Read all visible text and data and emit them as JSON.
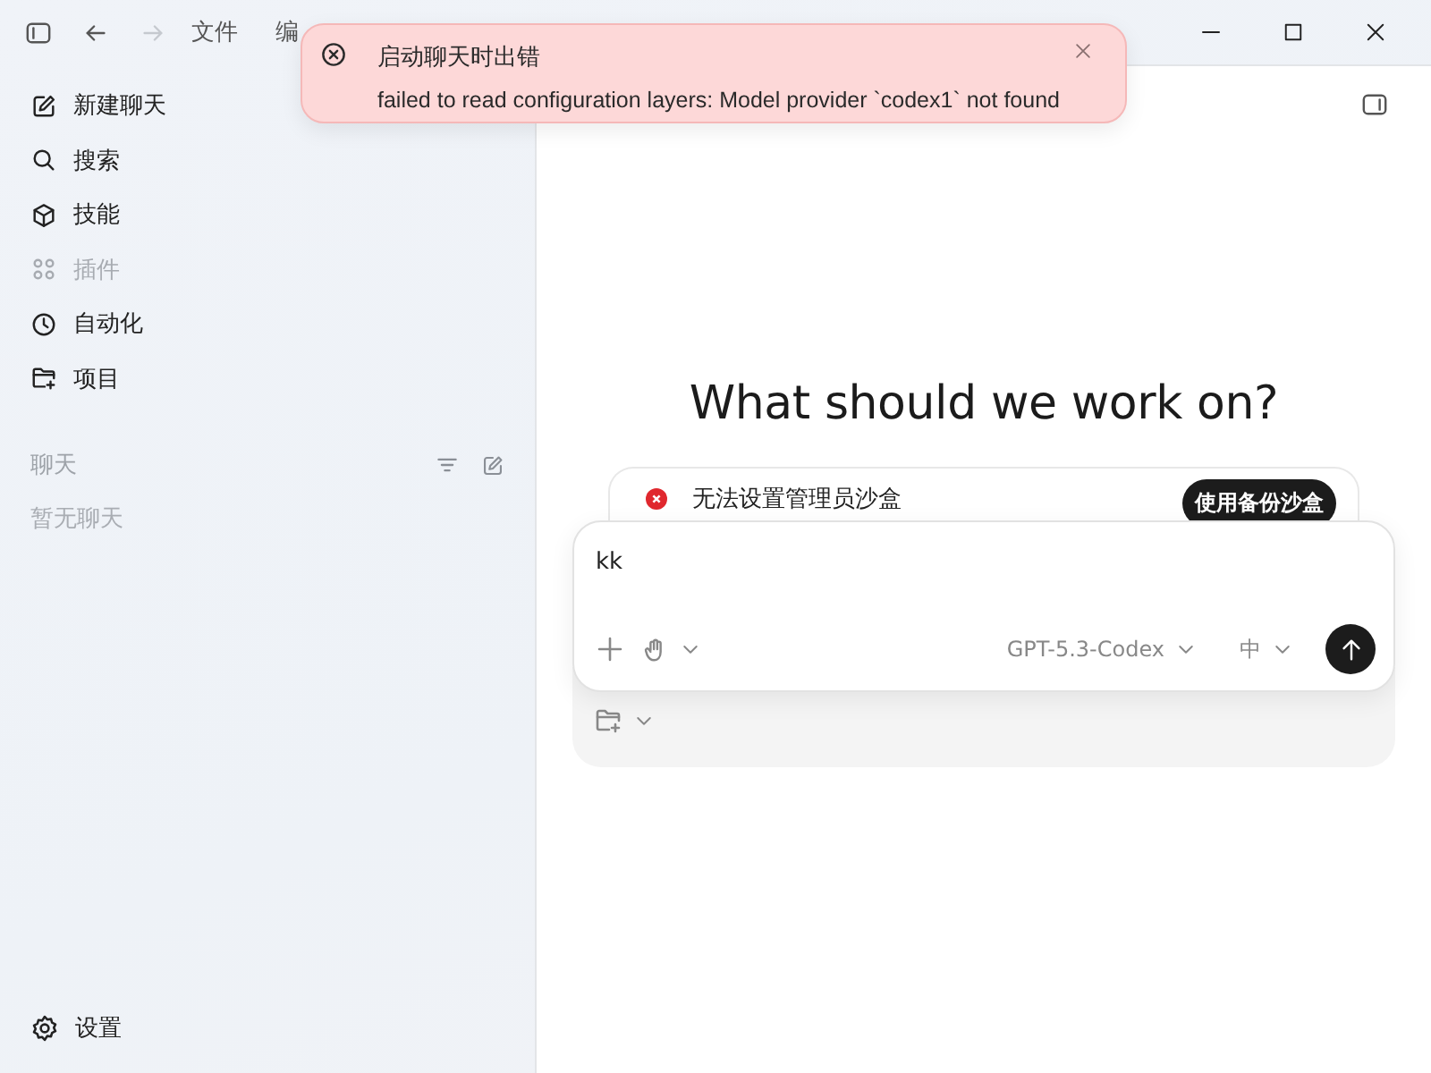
{
  "title_bar": {
    "back": {
      "disabled": false
    },
    "forward": {
      "disabled": true
    },
    "menus": [
      {
        "label": "文件"
      },
      {
        "label": "编"
      }
    ]
  },
  "toast": {
    "title": "启动聊天时出错",
    "message": "failed to read configuration layers: Model provider `codex1` not found"
  },
  "sidebar": {
    "items": [
      {
        "kind": "new",
        "label": "新建聊天",
        "disabled": false
      },
      {
        "kind": "search",
        "label": "搜索",
        "disabled": false
      },
      {
        "kind": "skills",
        "label": "技能",
        "disabled": false
      },
      {
        "kind": "plugins",
        "label": "插件",
        "disabled": true
      },
      {
        "kind": "automation",
        "label": "自动化",
        "disabled": false
      },
      {
        "kind": "project",
        "label": "项目",
        "disabled": false
      }
    ],
    "chats": {
      "title": "聊天",
      "empty_text": "暂无聊天"
    },
    "settings": {
      "label": "设置"
    }
  },
  "main": {
    "heading": "What should we work on?",
    "warning": {
      "text": "无法设置管理员沙盒",
      "action": "使用备份沙盒"
    },
    "composer": {
      "value": "kk",
      "model": "GPT-5.3-Codex",
      "effort": "中"
    }
  }
}
